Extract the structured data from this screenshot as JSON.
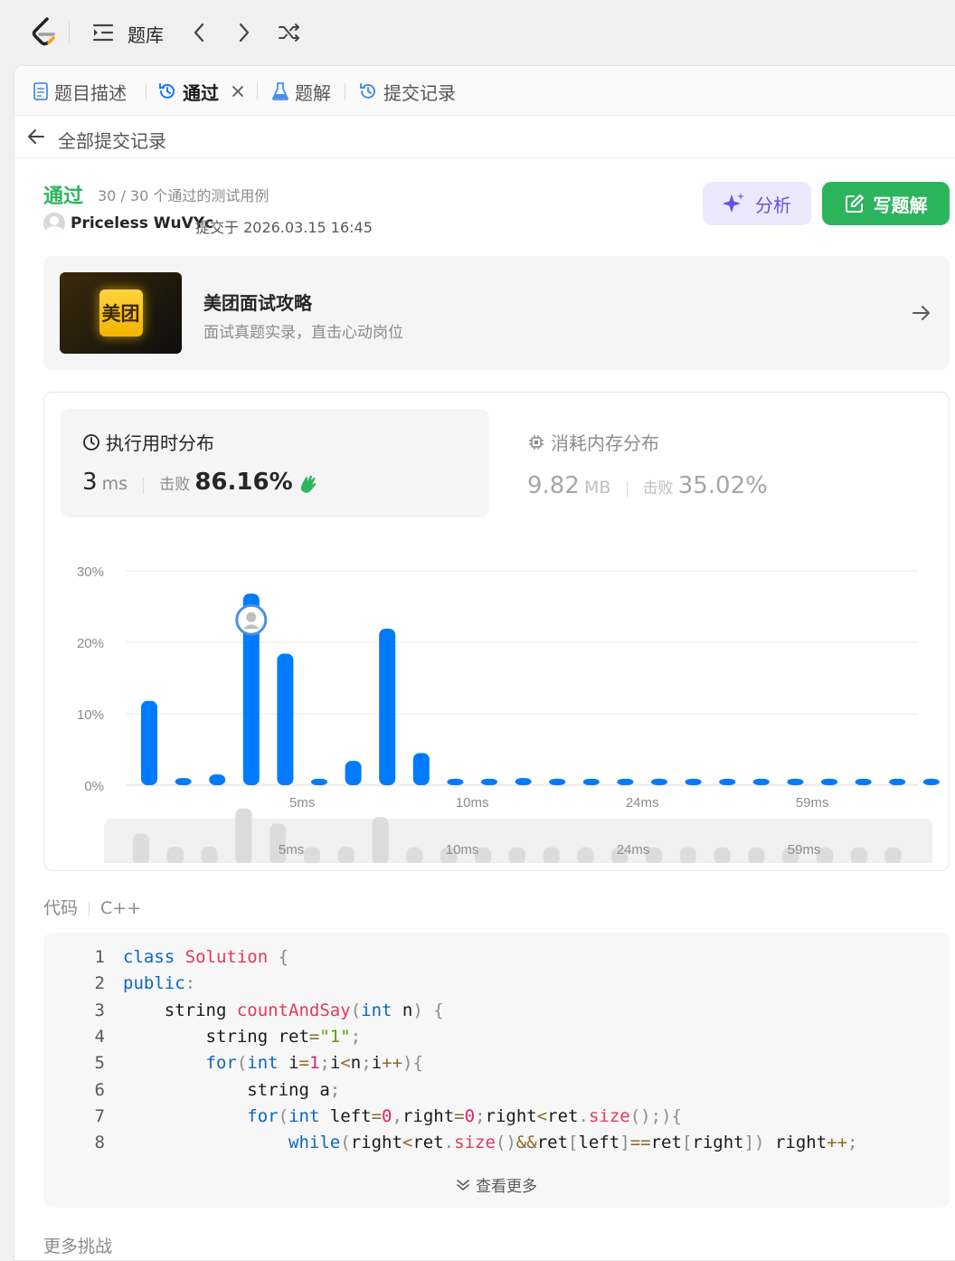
{
  "topbar": {
    "problem_list_label": "题库"
  },
  "tabs": [
    {
      "label": "题目描述"
    },
    {
      "label": "通过"
    },
    {
      "label": "题解"
    },
    {
      "label": "提交记录"
    }
  ],
  "back_label": "全部提交记录",
  "submission": {
    "status": "通过",
    "cases": "30 / 30 个通过的测试用例",
    "user": "Priceless WuVYc",
    "submitted_at": "提交于 2026.03.15 16:45"
  },
  "buttons": {
    "analyze": "分析",
    "write_solution": "写题解"
  },
  "promo": {
    "logo_text": "美团",
    "title": "美团面试攻略",
    "subtitle": "面试真题实录，直击心动岗位"
  },
  "runtime": {
    "title": "执行用时分布",
    "value": "3",
    "unit": "ms",
    "beat_label": "击败",
    "beat_value": "86.16%"
  },
  "memory": {
    "title": "消耗内存分布",
    "value": "9.82",
    "unit": "MB",
    "beat_label": "击败",
    "beat_value": "35.02%"
  },
  "chart_data": {
    "type": "bar",
    "ylim": [
      0,
      30
    ],
    "yticks": [
      "30%",
      "20%",
      "10%",
      "0%"
    ],
    "xtick_labels": [
      {
        "index": 5,
        "label": "5ms"
      },
      {
        "index": 10,
        "label": "10ms"
      },
      {
        "index": 15,
        "label": "24ms"
      },
      {
        "index": 20,
        "label": "59ms"
      }
    ],
    "values": [
      11.8,
      1.0,
      1.5,
      26.8,
      18.4,
      0.9,
      3.4,
      21.9,
      4.5,
      0.9,
      0.9,
      1.0,
      0.9,
      0.9,
      0.9,
      0.9,
      0.9,
      0.9,
      0.9,
      0.9,
      0.9,
      0.9,
      0.9,
      0.9
    ],
    "highlight_index": 3,
    "color": "#007aff",
    "minimap_values": [
      2.8,
      1.0,
      1.0,
      6.3,
      4.2,
      0.9,
      1.0,
      5.1,
      0.9,
      0.9,
      0.9,
      0.9,
      0.9,
      0.9,
      0.9,
      0.9,
      0.9,
      0.9,
      0.9,
      0.9,
      0.9,
      0.9,
      0.9
    ]
  },
  "code": {
    "label": "代码",
    "language": "C++",
    "lines": [
      "class Solution {",
      "public:",
      "    string countAndSay(int n) {",
      "        string ret=\"1\";",
      "        for(int i=1;i<n;i++){",
      "            string a;",
      "            for(int left=0,right=0;right<ret.size();){",
      "                while(right<ret.size()&&ret[left]==ret[right]) right++;"
    ],
    "more_label": "查看更多"
  },
  "more_challenges": "更多挑战",
  "colors": {
    "accepted": "#2db55d",
    "accent": "#007aff",
    "analyze_bg": "#ece9fe",
    "analyze_text": "#6b4ee6"
  }
}
